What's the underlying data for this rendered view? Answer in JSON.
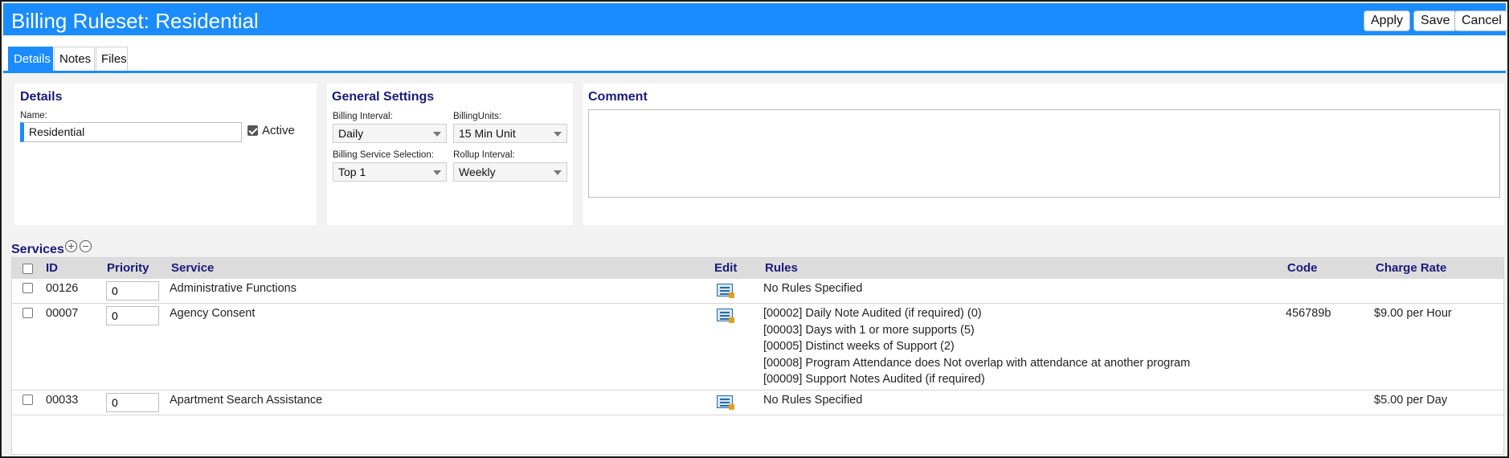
{
  "header": {
    "title": "Billing Ruleset: Residential",
    "buttons": {
      "apply": "Apply",
      "save": "Save",
      "cancel": "Cancel"
    }
  },
  "tabs": [
    {
      "label": "Details",
      "active": true
    },
    {
      "label": "Notes",
      "active": false
    },
    {
      "label": "Files",
      "active": false
    }
  ],
  "details": {
    "title": "Details",
    "name_label": "Name:",
    "name_value": "Residential",
    "active_label": "Active",
    "active_checked": true
  },
  "general": {
    "title": "General Settings",
    "billing_interval_label": "Billing Interval:",
    "billing_interval_value": "Daily",
    "billing_units_label": "BillingUnits:",
    "billing_units_value": "15 Min Unit",
    "service_selection_label": "Billing Service Selection:",
    "service_selection_value": "Top 1",
    "rollup_interval_label": "Rollup Interval:",
    "rollup_interval_value": "Weekly"
  },
  "comment": {
    "title": "Comment",
    "value": ""
  },
  "services": {
    "title": "Services",
    "columns": {
      "id": "ID",
      "priority": "Priority",
      "service": "Service",
      "edit": "Edit",
      "rules": "Rules",
      "code": "Code",
      "charge_rate": "Charge Rate"
    },
    "rows": [
      {
        "id": "00126",
        "priority": "0",
        "service": "Administrative Functions",
        "rules": [
          "No Rules Specified"
        ],
        "code": "",
        "charge_rate": ""
      },
      {
        "id": "00007",
        "priority": "0",
        "service": "Agency Consent",
        "rules": [
          "[00002] Daily Note Audited (if required) (0)",
          "[00003] Days with 1 or more supports (5)",
          "[00005] Distinct weeks of Support (2)",
          "[00008] Program Attendance does Not overlap with attendance at another program",
          "[00009] Support Notes Audited (if required)"
        ],
        "code": "456789b",
        "charge_rate": "$9.00 per Hour"
      },
      {
        "id": "00033",
        "priority": "0",
        "service": "Apartment Search Assistance",
        "rules": [
          "No Rules Specified"
        ],
        "code": "",
        "charge_rate": "$5.00 per Day"
      }
    ]
  },
  "icons": {
    "add": "plus-circle-icon",
    "remove": "minus-circle-icon",
    "edit": "edit-rules-icon",
    "dropdown": "chevron-down-icon",
    "checkbox": "checkbox-icon"
  },
  "colors": {
    "accent": "#1a8cff",
    "heading": "#1a1a7a",
    "header_row": "#dcdcdc"
  }
}
